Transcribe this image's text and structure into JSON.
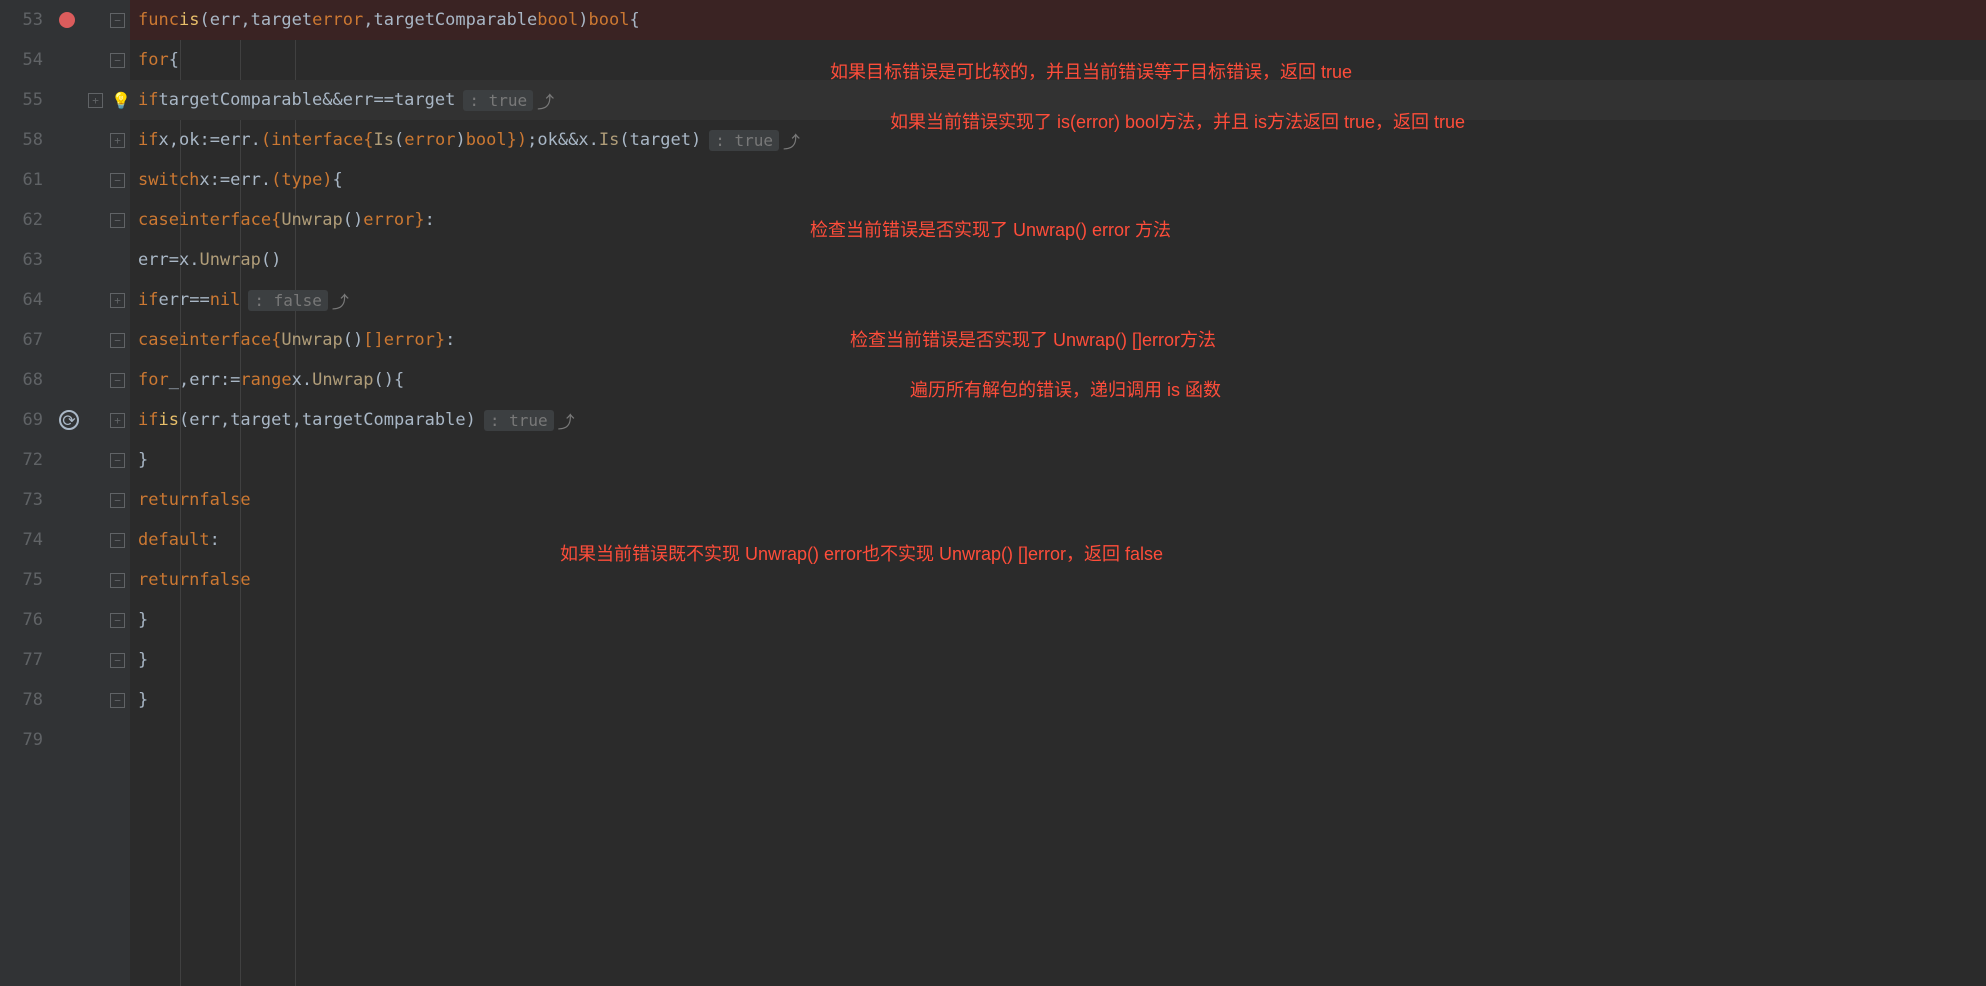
{
  "gutter": {
    "lines": [
      "53",
      "54",
      "55",
      "58",
      "61",
      "62",
      "63",
      "64",
      "67",
      "68",
      "69",
      "72",
      "73",
      "74",
      "75",
      "76",
      "77",
      "78",
      "79"
    ],
    "breakpoint_line": "53",
    "bulb_line": "55",
    "reload_line": "69",
    "fold_plus": [
      "55",
      "58",
      "64",
      "69"
    ],
    "fold_minus": [
      "53",
      "54",
      "61",
      "62",
      "67",
      "68",
      "72",
      "73",
      "74",
      "75",
      "76",
      "77",
      "78"
    ]
  },
  "code": {
    "l53": {
      "kw": "func",
      "name": "is",
      "params_open": "(",
      "p1": "err",
      "comma1": ",",
      "p2": "target",
      "type1": "error",
      "comma2": ",",
      "p3": "targetComparable",
      "type2": "bool",
      "params_close": ")",
      "ret": "bool",
      "brace": "{"
    },
    "l54": {
      "kw": "for",
      "brace": "{"
    },
    "l55": {
      "kw": "if",
      "p": "targetComparable",
      "op": "&&",
      "e": "err",
      "eq": "==",
      "t": "target",
      "hint": ": true"
    },
    "l58": {
      "kw": "if",
      "x": "x",
      "c1": ",",
      "ok": "ok",
      "asn": ":=",
      "e": "err",
      "dot": ".",
      "intf": "(interface{",
      "is": "Is",
      "p1": "(",
      "et": "error",
      "p2": ")",
      "bt": "bool",
      "end": "})",
      "sc": ";",
      "ok2": "ok",
      "and": "&&",
      "x2": "x",
      "d2": ".",
      "ism": "Is",
      "p3": "(",
      "tgt": "target",
      "p4": ")",
      "hint": ": true"
    },
    "l61": {
      "kw": "switch",
      "x": "x",
      "asn": ":=",
      "e": "err",
      "dot": ".",
      "tp": "(type)",
      "brace": "{"
    },
    "l62": {
      "kw": "case",
      "intf": "interface{",
      "uw": "Unwrap",
      "p": "()",
      "et": "error",
      "end": "}",
      "c": ":"
    },
    "l63": {
      "e": "err",
      "eq": "=",
      "x": "x",
      "d": ".",
      "uw": "Unwrap",
      "p": "()"
    },
    "l64": {
      "kw": "if",
      "e": "err",
      "eq": "==",
      "n": "nil",
      "hint": ": false"
    },
    "l67": {
      "kw": "case",
      "intf": "interface{",
      "uw": "Unwrap",
      "p": "()",
      "et": "[]error",
      "end": "}",
      "c": ":"
    },
    "l68": {
      "kw": "for",
      "u": "_",
      "c": ",",
      "e": "err",
      "asn": ":=",
      "r": "range",
      "x": "x",
      "d": ".",
      "uw": "Unwrap",
      "p": "()",
      "brace": "{"
    },
    "l69": {
      "kw": "if",
      "fn": "is",
      "p1": "(",
      "e": "err",
      "c1": ",",
      "t": "target",
      "c2": ",",
      "tc": "targetComparable",
      "p2": ")",
      "hint": ": true"
    },
    "l72": {
      "brace": "}"
    },
    "l73": {
      "kw": "return",
      "v": "false"
    },
    "l74": {
      "kw": "default",
      "c": ":"
    },
    "l75": {
      "kw": "return",
      "v": "false"
    },
    "l76": {
      "brace": "}"
    },
    "l77": {
      "brace": "}"
    },
    "l78": {
      "brace": "}"
    }
  },
  "annotations": {
    "a1": "如果目标错误是可比较的，并且当前错误等于目标错误，返回 true",
    "a2": "如果当前错误实现了 is(error) bool方法，并且 is方法返回 true，返回 true",
    "a3": "检查当前错误是否实现了 Unwrap() error 方法",
    "a4": "检查当前错误是否实现了 Unwrap() []error方法",
    "a5": "遍历所有解包的错误，递归调用 is 函数",
    "a6": "如果当前错误既不实现 Unwrap() error也不实现 Unwrap() []error，返回 false"
  }
}
